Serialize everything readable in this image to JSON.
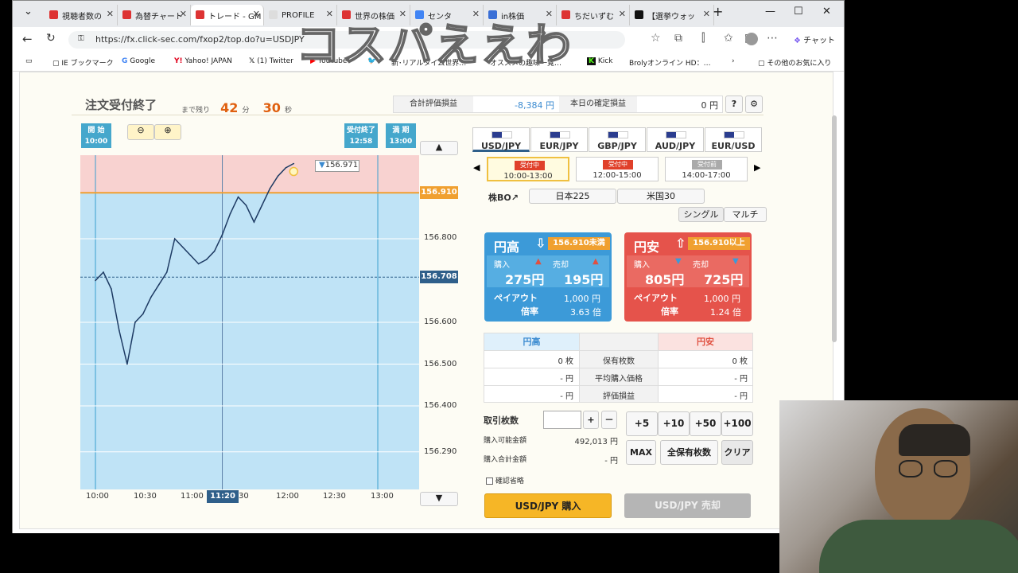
{
  "browser": {
    "tabs": [
      "視聴者数の",
      "為替チャート",
      "トレード - GM",
      "PROFILE",
      "世界の株価",
      "センタ",
      "in株価",
      "ちだいずむ",
      "【選挙ウォッ"
    ],
    "url": "https://fx.click-sec.com/fxop2/top.do?u=USDJPY",
    "chat": "チャット",
    "bookmarks": [
      "IE ブックマーク",
      "Google",
      "Yahoo! JAPAN",
      "(1) Twitter",
      "YouTube",
      "新･リアルタイム世界…",
      "オススメの趣味一覧…",
      "Kick",
      "Brolyオンライン HD：…",
      "その他のお気に入り"
    ]
  },
  "overlay_text": "コスパええわ",
  "header": {
    "title": "注文受付終了",
    "remaining": "まで残り",
    "minutes": "42",
    "min_unit": "分",
    "seconds": "30",
    "sec_unit": "秒",
    "pl_label": "合計評価損益",
    "pl_value": "-8,384 円",
    "fixed_label": "本日の確定損益",
    "fixed_value": "0 円",
    "help": "?",
    "settings": "gear-icon"
  },
  "chart_markers": {
    "start": "開 始",
    "start_time": "10:00",
    "close_label": "受付終了",
    "close_time": "12:58",
    "expiry_label": "満 期",
    "expiry_time": "13:00",
    "price_tag": "156.971",
    "strike_tag": "156.910",
    "current_tag": "156.708",
    "hover_time": "11:20"
  },
  "chart_data": {
    "type": "line",
    "series": [
      {
        "values": [
          {
            "x": "10:00",
            "y": 156.7
          },
          {
            "x": "10:05",
            "y": 156.72
          },
          {
            "x": "10:10",
            "y": 156.68
          },
          {
            "x": "10:15",
            "y": 156.58
          },
          {
            "x": "10:20",
            "y": 156.5
          },
          {
            "x": "10:25",
            "y": 156.6
          },
          {
            "x": "10:30",
            "y": 156.62
          },
          {
            "x": "10:35",
            "y": 156.66
          },
          {
            "x": "10:40",
            "y": 156.69
          },
          {
            "x": "10:45",
            "y": 156.72
          },
          {
            "x": "10:50",
            "y": 156.8
          },
          {
            "x": "10:55",
            "y": 156.78
          },
          {
            "x": "11:00",
            "y": 156.76
          },
          {
            "x": "11:05",
            "y": 156.74
          },
          {
            "x": "11:10",
            "y": 156.75
          },
          {
            "x": "11:15",
            "y": 156.77
          },
          {
            "x": "11:20",
            "y": 156.81
          },
          {
            "x": "11:25",
            "y": 156.86
          },
          {
            "x": "11:30",
            "y": 156.9
          },
          {
            "x": "11:35",
            "y": 156.88
          },
          {
            "x": "11:40",
            "y": 156.84
          },
          {
            "x": "11:45",
            "y": 156.88
          },
          {
            "x": "11:50",
            "y": 156.92
          },
          {
            "x": "11:55",
            "y": 156.95
          },
          {
            "x": "12:00",
            "y": 156.97
          },
          {
            "x": "12:05",
            "y": 156.98
          }
        ]
      }
    ],
    "ylim": [
      156.2,
      157.0
    ],
    "yticks": [
      "156.800",
      "156.600",
      "156.500",
      "156.400",
      "156.290"
    ],
    "xticks": [
      "10:00",
      "10:30",
      "11:00",
      "30",
      "12:00",
      "12:30",
      "13:00"
    ],
    "strike": 156.91,
    "current": 156.708,
    "colors": {
      "line": "#1d3a63",
      "upper_zone": "#f8d2d0",
      "lower_zone": "#bfe3f6",
      "strike_line": "#f0a030"
    }
  },
  "currencies": [
    "USD/JPY",
    "EUR/JPY",
    "GBP/JPY",
    "AUD/JPY",
    "EUR/USD"
  ],
  "sessions": [
    {
      "badge": "受付中",
      "time": "10:00-13:00"
    },
    {
      "badge": "受付中",
      "time": "12:00-15:00"
    },
    {
      "badge": "受付前",
      "time": "14:00-17:00"
    }
  ],
  "markets": {
    "label": "株BO↗",
    "nikkei": "日本225",
    "us30": "米国30"
  },
  "modes": {
    "single": "シングル",
    "multi": "マルチ"
  },
  "up_card": {
    "title": "円高",
    "cond": "156.910未満",
    "buy_label": "購入",
    "buy_price": "275円",
    "sell_label": "売却",
    "sell_price": "195円",
    "payout_label": "ペイアウト",
    "payout": "1,000 円",
    "ratio_label": "倍率",
    "ratio": "3.63 倍"
  },
  "down_card": {
    "title": "円安",
    "cond": "156.910以上",
    "buy_label": "購入",
    "buy_price": "805円",
    "sell_label": "売却",
    "sell_price": "725円",
    "payout_label": "ペイアウト",
    "payout": "1,000 円",
    "ratio_label": "倍率",
    "ratio": "1.24 倍"
  },
  "holdings": {
    "up_head": "円高",
    "down_head": "円安",
    "rows": [
      {
        "label": "保有枚数",
        "up": "0 枚",
        "down": "0 枚"
      },
      {
        "label": "平均購入価格",
        "up": "- 円",
        "down": "- 円"
      },
      {
        "label": "評価損益",
        "up": "- 円",
        "down": "- 円"
      }
    ]
  },
  "order": {
    "qty_label": "取引枚数",
    "qty_value": "",
    "plus": "+",
    "minus": "－",
    "available_label": "購入可能金額",
    "available": "492,013 円",
    "total_label": "購入合計金額",
    "total": "- 円",
    "quick": [
      "+5",
      "+10",
      "+50",
      "+100"
    ],
    "max": "MAX",
    "all": "全保有枚数",
    "clear": "クリア",
    "confirm_skip": "確認省略",
    "buy_button": "USD/JPY 購入",
    "sell_button": "USD/JPY 売却"
  }
}
